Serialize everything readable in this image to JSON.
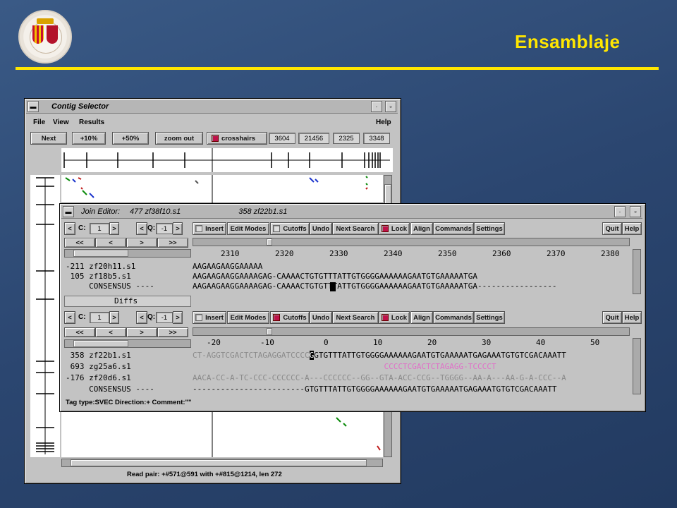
{
  "slide": {
    "title": "Ensamblaje"
  },
  "logo": {
    "text": ""
  },
  "contig_selector": {
    "window_title": "Contig Selector",
    "menus": [
      "File",
      "View",
      "Results"
    ],
    "help": "Help",
    "toolbar": {
      "next": "Next",
      "zoom_in_10": "+10%",
      "zoom_in_50": "+50%",
      "zoom_out": "zoom out",
      "crosshairs": "crosshairs",
      "values": [
        "3604",
        "21456",
        "2325",
        "3348"
      ]
    },
    "status": "Read pair: +#571@591 with +#815@1214, len 272"
  },
  "join_editor": {
    "window_title": "Join Editor:",
    "contig_a": "477 zf38f10.s1",
    "contig_b": "358 zf22b1.s1",
    "top": {
      "c_label": "C:",
      "c_value": "1",
      "q_label": "Q:",
      "q_value": "-1",
      "buttons": [
        "Insert",
        "Edit Modes",
        "Cutoffs",
        "Undo",
        "Next Search",
        "Lock",
        "Align",
        "Commands",
        "Settings"
      ],
      "quit": "Quit",
      "help": "Help",
      "nav": [
        "<<",
        "<",
        ">",
        ">>"
      ],
      "ruler": [
        "2310",
        "2320",
        "2330",
        "2340",
        "2350",
        "2360",
        "2370",
        "2380"
      ],
      "rows": [
        {
          "label": "-211 zf20h11.s1",
          "seq": "AAGAAGAAGGAAAAA"
        },
        {
          "label": " 105 zf18b5.s1",
          "seq": "AAGAAGAAGGAAAAGAG-CAAAACTGTGTTTATTGTGGGGAAAAAAGAATGTGAAAAATGA"
        },
        {
          "label": "     CONSENSUS ----",
          "seq": "AAGAAGAAGGAAAAGAG-CAAAACTGTGTTTATTGTGGGGAAAAAAGAATGTGAAAAATGA-----------------"
        }
      ]
    },
    "diffs": "Diffs",
    "bottom": {
      "c_label": "C:",
      "c_value": "1",
      "q_label": "Q:",
      "q_value": "-1",
      "buttons": [
        "Insert",
        "Edit Modes",
        "Cutoffs",
        "Undo",
        "Next Search",
        "Lock",
        "Align",
        "Commands",
        "Settings"
      ],
      "quit": "Quit",
      "help": "Help",
      "nav": [
        "<<",
        "<",
        ">",
        ">>"
      ],
      "ruler": [
        "-20",
        "-10",
        "0",
        "10",
        "20",
        "30",
        "40",
        "50"
      ],
      "rows": [
        {
          "label": " 358 zf22b1.s1",
          "seq_grey": "CT-AGGTCGACTCTAGAGGATCCCC",
          "seq": "GTGTTTATTGTGGGGAAAAAAGAATGTGAAAAATGAGAAATGTGTCGACAAATT"
        },
        {
          "label": " 693 zg25a6.s1",
          "pad": "                                         ",
          "seq_pink": "CCCCTCGACTCTAGAGG-TCCCCT"
        },
        {
          "label": "-176 zf20d6.s1",
          "seq_grey": "AACA-CC-A-TC-CCC-CCCCCC-A---CCCCCC--GG--GTA-ACC-CCG--TGGGG--AA-A---AA-G-A-CCC--A"
        },
        {
          "label": "     CONSENSUS ----",
          "seq": "------------------------GTGTTTATTGTGGGGAAAAAAGAATGTGAAAAATGAGAAATGTGTCGACAAATT"
        }
      ]
    },
    "status": "Tag type:SVEC   Direction:+    Comment:\"\""
  },
  "colors": {
    "accent_title": "#ffe600",
    "bg": "#2b4670",
    "window": "#c3c3c3",
    "pink": "#e070c8"
  }
}
